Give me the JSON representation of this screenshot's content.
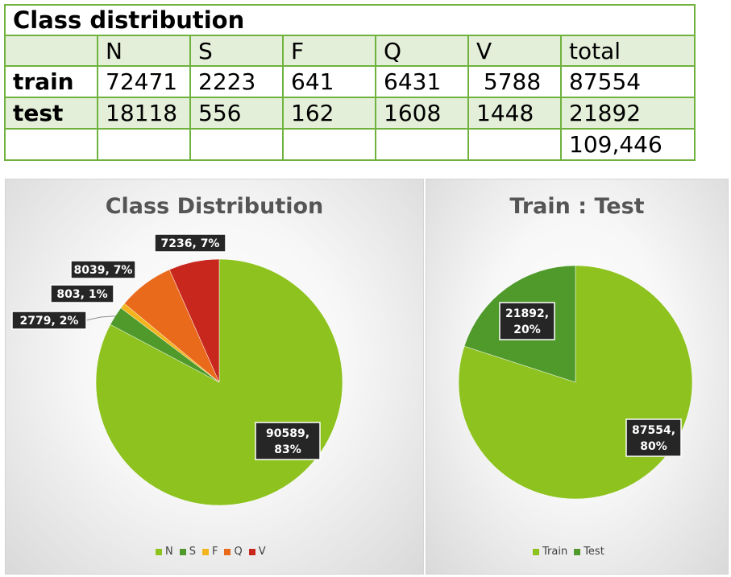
{
  "table": {
    "title": "Class distribution",
    "headers": [
      "",
      "N",
      "S",
      "F",
      "Q",
      "V",
      "total"
    ],
    "rows": [
      {
        "label": "train",
        "cells": [
          "72471",
          "2223",
          "641",
          "6431",
          " 5788",
          "87554"
        ]
      },
      {
        "label": "test",
        "cells": [
          "18118",
          "556",
          "162",
          "1608",
          "1448",
          "21892"
        ]
      },
      {
        "label": "",
        "cells": [
          "",
          "",
          "",
          "",
          "",
          "109,446"
        ]
      }
    ]
  },
  "colors": {
    "N": "#8dc21f",
    "S": "#4f9a2b",
    "F": "#f2b51d",
    "Q": "#ea6a1c",
    "V": "#c8271d",
    "Train": "#8dc21f",
    "Test": "#4f9a2b",
    "table_border": "#6fb23e",
    "table_band": "#e3efd9"
  },
  "chart_data": [
    {
      "type": "pie",
      "title": "Class Distribution",
      "categories": [
        "N",
        "S",
        "F",
        "Q",
        "V"
      ],
      "values": [
        90589,
        2779,
        803,
        8039,
        7236
      ],
      "percent_labels": [
        "83%",
        "2%",
        "1%",
        "7%",
        "7%"
      ],
      "legend": {
        "position": "bottom",
        "entries": [
          "N",
          "S",
          "F",
          "Q",
          "V"
        ]
      }
    },
    {
      "type": "pie",
      "title": "Train : Test",
      "categories": [
        "Train",
        "Test"
      ],
      "values": [
        87554,
        21892
      ],
      "percent_labels": [
        "80%",
        "20%"
      ],
      "legend": {
        "position": "bottom",
        "entries": [
          "Train",
          "Test"
        ]
      }
    }
  ]
}
